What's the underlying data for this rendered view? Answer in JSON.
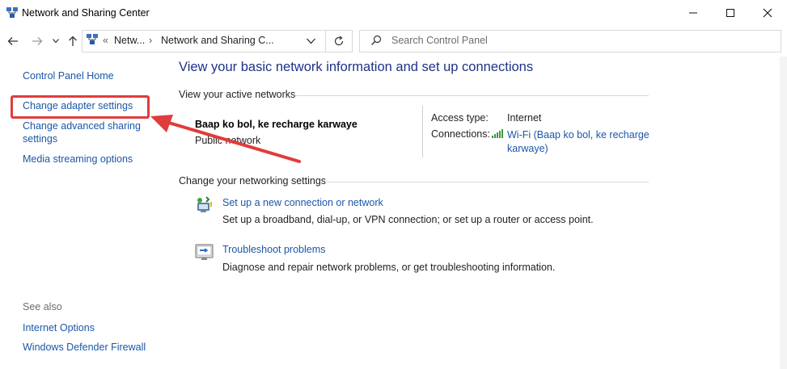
{
  "window": {
    "title": "Network and Sharing Center",
    "controls": {
      "minimize": "—",
      "maximize": "☐",
      "close": "✕"
    }
  },
  "nav": {
    "back": "←",
    "forward": "→",
    "recent": "⌄",
    "up": "↑",
    "breadcrumb": {
      "overflow": "«",
      "item1": "Netw...",
      "separator": "›",
      "item2": "Network and Sharing C...",
      "dropdown": "⌄"
    },
    "refresh": "↻",
    "search_placeholder": "Search Control Panel"
  },
  "sidebar": {
    "home": "Control Panel Home",
    "links": [
      "Change adapter settings",
      "Change advanced sharing settings",
      "Media streaming options"
    ],
    "see_also_title": "See also",
    "see_also": [
      "Internet Options",
      "Windows Defender Firewall"
    ]
  },
  "main": {
    "heading": "View your basic network information and set up connections",
    "active_networks_title": "View your active networks",
    "network_name": "Baap ko bol, ke recharge karwaye",
    "network_type": "Public network",
    "access_type_label": "Access type:",
    "access_type_value": "Internet",
    "connections_label": "Connections:",
    "connection_link": "Wi-Fi (Baap ko bol, ke recharge karwaye)",
    "change_settings_title": "Change your networking settings",
    "tasks": [
      {
        "title": "Set up a new connection or network",
        "desc": "Set up a broadband, dial-up, or VPN connection; or set up a router or access point.",
        "icon": "new-connection-icon"
      },
      {
        "title": "Troubleshoot problems",
        "desc": "Diagnose and repair network problems, or get troubleshooting information.",
        "icon": "troubleshoot-icon"
      }
    ]
  },
  "annotation": {
    "color": "#e03c3c"
  }
}
